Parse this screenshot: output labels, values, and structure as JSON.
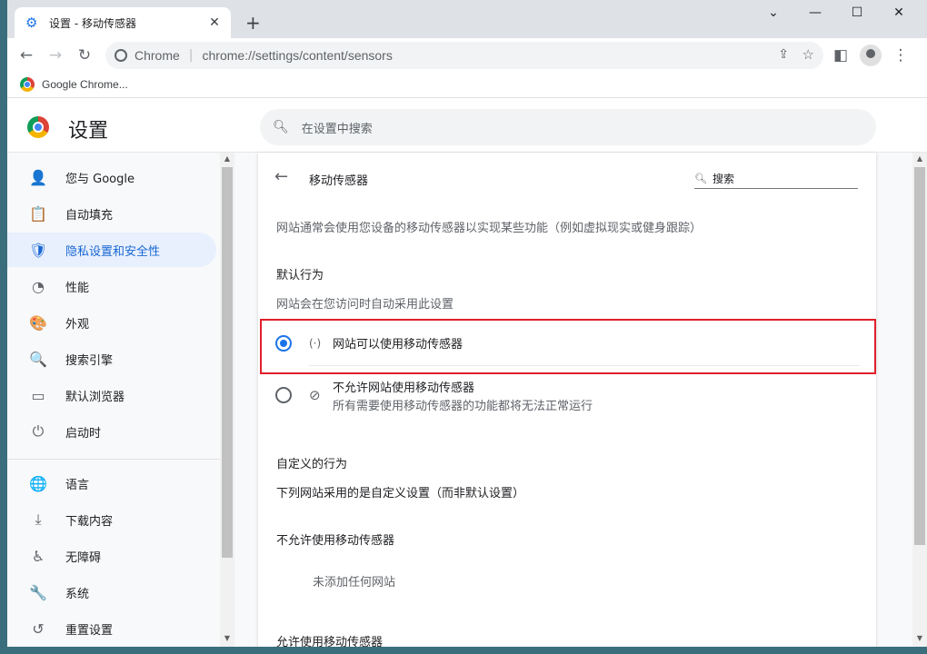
{
  "tab": {
    "title": "设置 - 移动传感器",
    "close": "✕",
    "new_tab": "+"
  },
  "window_controls": {
    "minimize": "—",
    "maximize": "☐",
    "close": "✕",
    "dropdown": "⌄"
  },
  "toolbar": {
    "back": "←",
    "forward": "→",
    "reload": "↻",
    "site": "Chrome",
    "url": "chrome://settings/content/sensors",
    "menu": "⋮"
  },
  "bookmarks": [
    {
      "label": "Google Chrome..."
    }
  ],
  "header": {
    "title": "设置",
    "search_placeholder": "在设置中搜索"
  },
  "sidebar": {
    "items": [
      {
        "label": "您与 Google",
        "icon": "person-icon",
        "glyph": "👤"
      },
      {
        "label": "自动填充",
        "icon": "clipboard-icon",
        "glyph": "📋"
      },
      {
        "label": "隐私设置和安全性",
        "icon": "shield-icon",
        "glyph": "🛡",
        "active": true
      },
      {
        "label": "性能",
        "icon": "gauge-icon",
        "glyph": "◔"
      },
      {
        "label": "外观",
        "icon": "palette-icon",
        "glyph": "🎨"
      },
      {
        "label": "搜索引擎",
        "icon": "search-icon",
        "glyph": "🔍"
      },
      {
        "label": "默认浏览器",
        "icon": "browser-icon",
        "glyph": "▭"
      },
      {
        "label": "启动时",
        "icon": "power-icon",
        "glyph": "⏻"
      },
      {
        "label": "语言",
        "icon": "globe-icon",
        "glyph": "🌐"
      },
      {
        "label": "下载内容",
        "icon": "download-icon",
        "glyph": "⤓"
      },
      {
        "label": "无障碍",
        "icon": "accessibility-icon",
        "glyph": "♿"
      },
      {
        "label": "系统",
        "icon": "wrench-icon",
        "glyph": "🔧"
      },
      {
        "label": "重置设置",
        "icon": "reset-icon",
        "glyph": "↺"
      }
    ]
  },
  "page": {
    "title": "移动传感器",
    "search_label": "搜索",
    "description": "网站通常会使用您设备的移动传感器以实现某些功能（例如虚拟现实或健身跟踪）",
    "default_heading": "默认行为",
    "default_sub": "网站会在您访问时自动采用此设置",
    "options": [
      {
        "label": "网站可以使用移动传感器",
        "icon": "sensor-icon",
        "glyph": "(·)",
        "selected": true
      },
      {
        "label": "不允许网站使用移动传感器",
        "sub": "所有需要使用移动传感器的功能都将无法正常运行",
        "icon": "sensor-off-icon",
        "glyph": "⊘",
        "selected": false
      }
    ],
    "custom_heading": "自定义的行为",
    "custom_sub": "下列网站采用的是自定义设置（而非默认设置）",
    "blocked_heading": "不允许使用移动传感器",
    "blocked_empty": "未添加任何网站",
    "allowed_heading": "允许使用移动传感器"
  },
  "colors": {
    "accent": "#1a73e8",
    "highlight_border": "#e0202a",
    "active_nav_bg": "#e8f0fe"
  }
}
